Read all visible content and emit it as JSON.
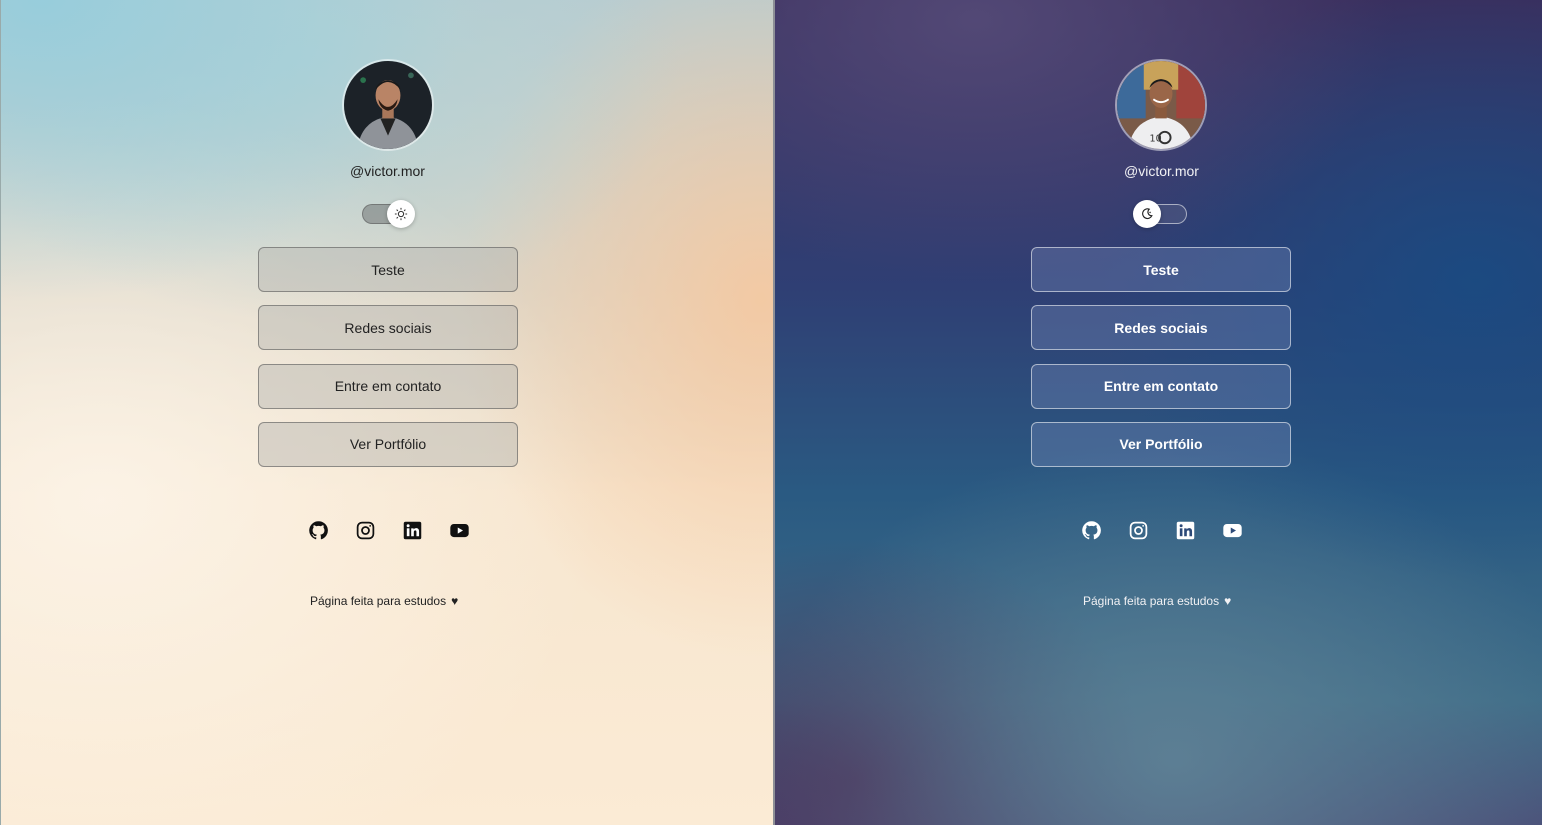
{
  "light": {
    "handle": "@victor.mor",
    "theme_icon": "sun-icon",
    "buttons": [
      "Teste",
      "Redes sociais",
      "Entre em contato",
      "Ver Portfólio"
    ],
    "socials": [
      "github-icon",
      "instagram-icon",
      "linkedin-icon",
      "youtube-icon"
    ],
    "footer": "Página feita para estudos",
    "heart": "♥"
  },
  "dark": {
    "handle": "@victor.mor",
    "theme_icon": "moon-icon",
    "buttons": [
      "Teste",
      "Redes sociais",
      "Entre em contato",
      "Ver Portfólio"
    ],
    "socials": [
      "github-icon",
      "instagram-icon",
      "linkedin-icon",
      "youtube-icon"
    ],
    "footer": "Página feita para estudos",
    "heart": "♥"
  },
  "colors": {
    "light_text": "#222222",
    "dark_text": "#ffffff"
  }
}
